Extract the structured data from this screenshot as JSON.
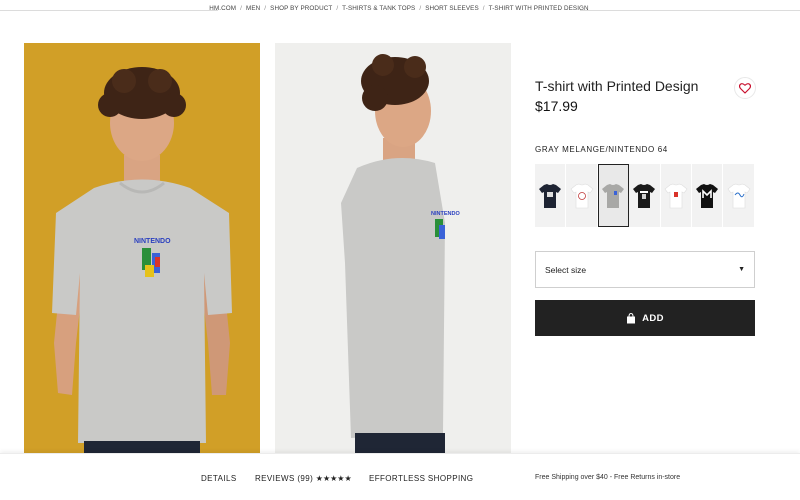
{
  "breadcrumb": {
    "items": [
      "HM.COM",
      "MEN",
      "SHOP BY PRODUCT",
      "T-SHIRTS & TANK TOPS",
      "SHORT SLEEVES",
      "T-SHIRT WITH PRINTED DESIGN"
    ],
    "separator": "/"
  },
  "gallery": {
    "image1_background": "#d19f27",
    "image2_background": "#efefed",
    "tshirt_color": "#c9c9c7",
    "print_text": "NINTENDO"
  },
  "product": {
    "title": "T-shirt with Printed Design",
    "price": "$17.99",
    "color_name": "GRAY MELANGE/NINTENDO 64",
    "favorite_icon": "heart-outline-icon",
    "accent_color": "#c8102e"
  },
  "swatches": [
    {
      "color": "#1e2433",
      "icon": "tshirt-thumb"
    },
    {
      "color": "#ffffff",
      "icon": "tshirt-thumb"
    },
    {
      "color": "#a8a8a6",
      "icon": "tshirt-thumb",
      "selected": true
    },
    {
      "color": "#1a1a1a",
      "icon": "tshirt-thumb"
    },
    {
      "color": "#ffffff",
      "icon": "tshirt-thumb"
    },
    {
      "color": "#111111",
      "icon": "tshirt-thumb"
    },
    {
      "color": "#ffffff",
      "icon": "tshirt-thumb"
    }
  ],
  "size_select": {
    "label": "Select size",
    "arrow_icon": "caret-down-icon"
  },
  "add_button": {
    "label": "ADD",
    "icon": "shopping-bag-icon",
    "background": "#222222"
  },
  "bottom_bar": {
    "details": "DETAILS",
    "reviews": "REVIEWS (99)",
    "stars": "★★★★★",
    "effortless": "EFFORTLESS SHOPPING",
    "shipping": "Free Shipping over $40 - Free Returns in-store"
  }
}
